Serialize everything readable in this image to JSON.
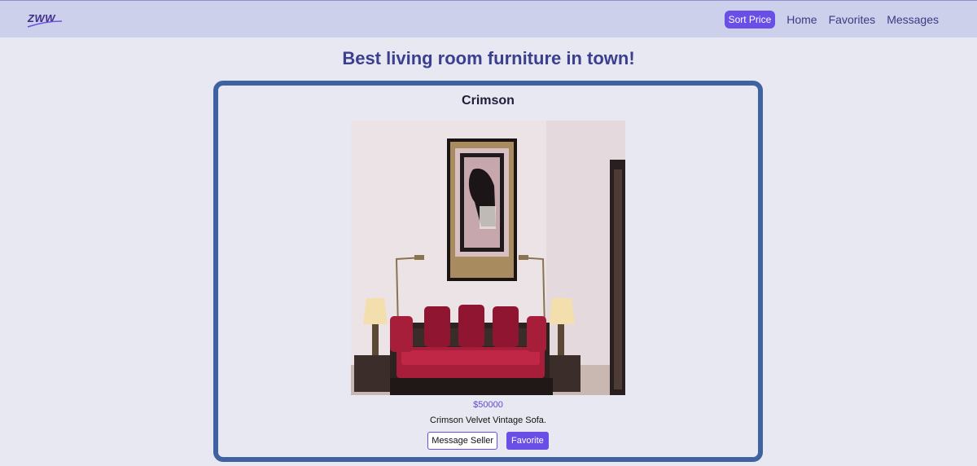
{
  "nav": {
    "logo_text": "ZWW",
    "sort_label": "Sort Price",
    "links": [
      "Home",
      "Favorites",
      "Messages"
    ]
  },
  "page": {
    "title": "Best living room furniture in town!"
  },
  "listing": {
    "name": "Crimson",
    "price": "$50000",
    "description": "Crimson Velvet Vintage Sofa.",
    "message_label": "Message Seller",
    "favorite_label": "Favorite"
  },
  "colors": {
    "accent": "#6a4fe6",
    "navbar": "#cdd0ea",
    "background": "#e7e8f1",
    "card_border": "#3f63a0",
    "title": "#3b3f8f"
  }
}
